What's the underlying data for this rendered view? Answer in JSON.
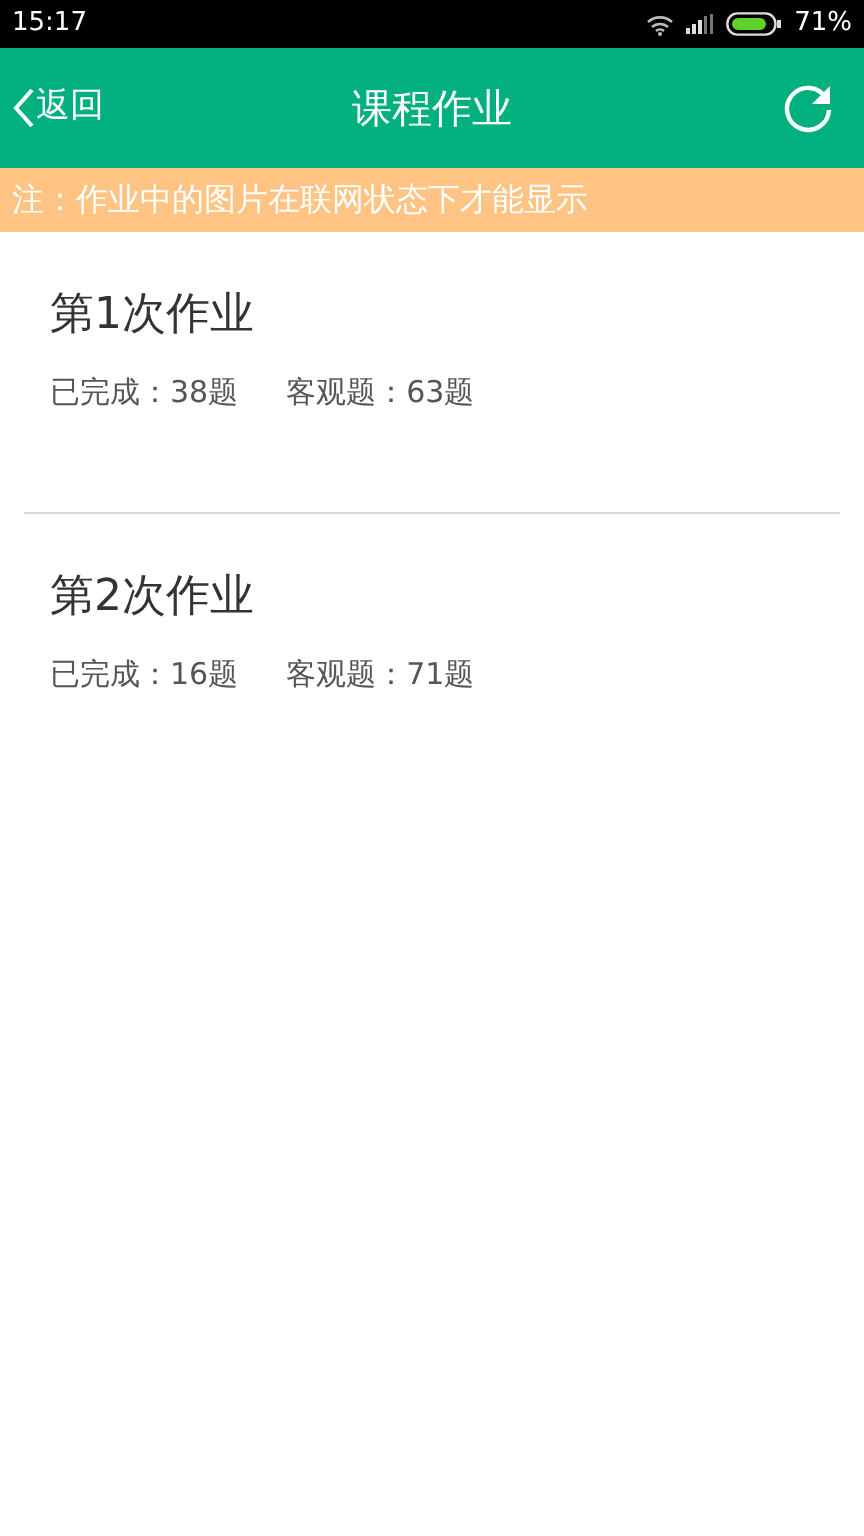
{
  "status_bar": {
    "time": "15:17",
    "battery": "71%"
  },
  "header": {
    "back": "返回",
    "title": "课程作业"
  },
  "notice": "注：作业中的图片在联网状态下才能显示",
  "assignments": [
    {
      "title": "第1次作业",
      "completed": "已完成：38题",
      "objective": "客观题：63题"
    },
    {
      "title": "第2次作业",
      "completed": "已完成：16题",
      "objective": "客观题：71题"
    }
  ]
}
